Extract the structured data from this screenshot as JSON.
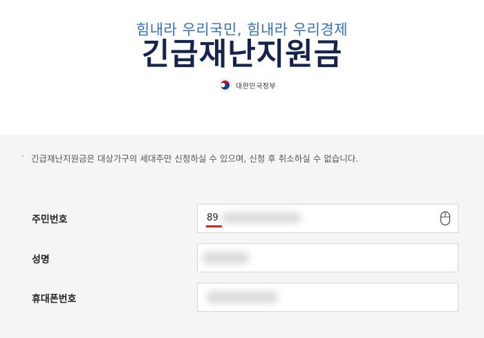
{
  "header": {
    "slogan": "힘내라 우리국민, 힘내라 우리경제",
    "title": "긴급재난지원금",
    "government": "대한민국정부",
    "emblem_icon": "taegeuk-emblem-icon"
  },
  "notice": {
    "bullet": "·",
    "text": "긴급재난지원금은 대상가구의 세대주만 신청하실 수 있으며, 신청 후 취소하실 수 없습니다."
  },
  "form": {
    "resident_number_label": "주민번호",
    "resident_number_value": "89",
    "name_label": "성명",
    "phone_label": "휴대폰번호",
    "mouse_icon": "mouse-icon"
  },
  "colors": {
    "slogan": "#2f6fc7",
    "title": "#13244f",
    "highlight": "#e02020",
    "panel_bg": "#f5f5f5"
  }
}
